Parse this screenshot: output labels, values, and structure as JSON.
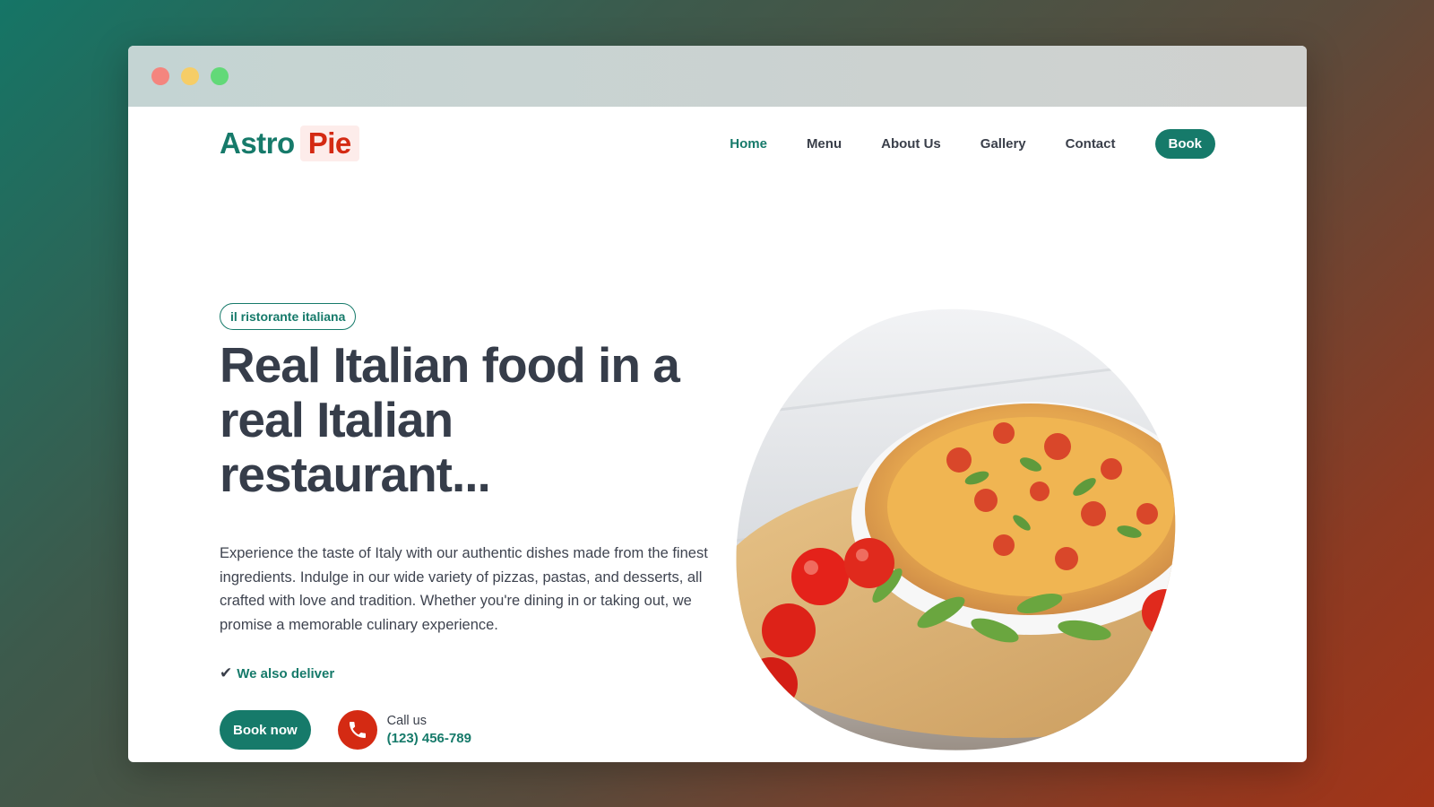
{
  "window": {
    "controls": [
      "close",
      "minimize",
      "maximize"
    ]
  },
  "logo": {
    "part1": "Astro",
    "part2": "Pie"
  },
  "nav": {
    "items": [
      {
        "label": "Home",
        "active": true
      },
      {
        "label": "Menu",
        "active": false
      },
      {
        "label": "About Us",
        "active": false
      },
      {
        "label": "Gallery",
        "active": false
      },
      {
        "label": "Contact",
        "active": false
      }
    ],
    "book_label": "Book"
  },
  "hero": {
    "tag": "il ristorante italiana",
    "headline": "Real Italian food in a real Italian restaurant...",
    "description": "Experience the taste of Italy with our authentic dishes made from the finest ingredients. Indulge in our wide variety of pizzas, pastas, and desserts, all crafted with love and tradition. Whether you're dining in or taking out, we promise a memorable culinary experience.",
    "deliver_check": "✔",
    "deliver_text": "We also deliver",
    "cta_label": "Book now",
    "call_label": "Call us",
    "call_number": "(123) 456-789",
    "image": "pizza-photo"
  },
  "colors": {
    "primary": "#167a6a",
    "accent": "#d42a13",
    "text": "#363d4a"
  }
}
